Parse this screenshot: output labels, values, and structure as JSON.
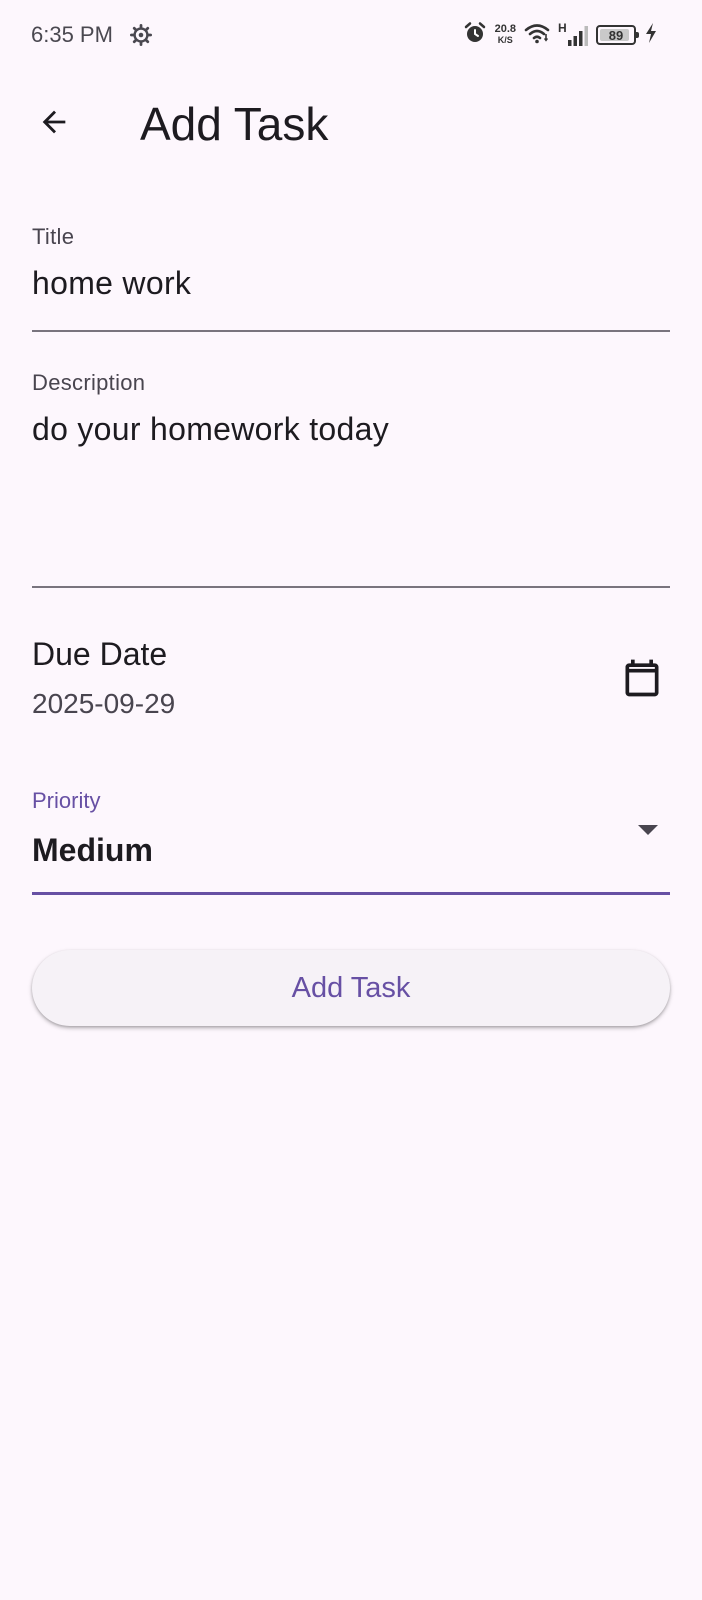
{
  "status_bar": {
    "time": "6:35 PM",
    "net_speed_value": "20.8",
    "net_speed_unit": "K/S",
    "network_type": "H",
    "battery_level": "89",
    "icons": [
      "gear-icon",
      "alarm-icon",
      "wifi-icon",
      "signal-icon",
      "battery-icon",
      "charging-icon"
    ]
  },
  "app_bar": {
    "title": "Add Task",
    "back_icon": "arrow-back-icon"
  },
  "form": {
    "title_field": {
      "label": "Title",
      "value": "home work"
    },
    "description_field": {
      "label": "Description",
      "value": "do your homework today"
    },
    "due_date": {
      "label": "Due Date",
      "value": "2025-09-29",
      "icon": "calendar-icon"
    },
    "priority": {
      "label": "Priority",
      "selected": "Medium"
    },
    "submit_label": "Add Task"
  },
  "colors": {
    "background": "#fdf7fd",
    "accent": "#6750a4",
    "text_primary": "#1d1b20",
    "text_secondary": "#49454f",
    "underline": "#79747e",
    "button_bg": "#f6f2f7"
  }
}
